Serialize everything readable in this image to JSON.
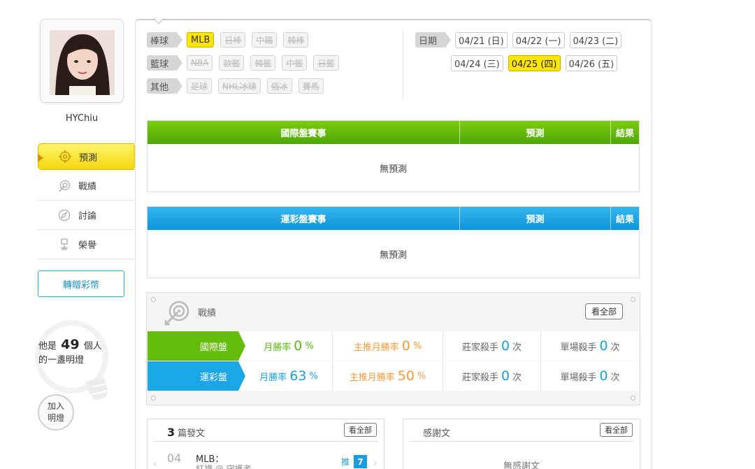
{
  "profile": {
    "username": "HYChiu"
  },
  "sidebar": {
    "items": [
      {
        "label": "預測",
        "icon": "target-icon",
        "active": true
      },
      {
        "label": "戰績",
        "icon": "record-icon",
        "active": false
      },
      {
        "label": "討論",
        "icon": "discuss-icon",
        "active": false
      },
      {
        "label": "榮譽",
        "icon": "medal-icon",
        "active": false
      }
    ],
    "donate_label": "轉贈彩幣",
    "lamp": {
      "prefix": "他是",
      "count": "49",
      "suffix": "個人",
      "line2": "的一盞明燈"
    },
    "join_lamp_line1": "加入",
    "join_lamp_line2": "明燈"
  },
  "categories": [
    {
      "label": "棒球",
      "items": [
        {
          "name": "MLB",
          "active": true
        },
        {
          "name": "日棒"
        },
        {
          "name": "中職"
        },
        {
          "name": "韓棒"
        }
      ]
    },
    {
      "label": "籃球",
      "items": [
        {
          "name": "NBA"
        },
        {
          "name": "歐籃"
        },
        {
          "name": "韓籃"
        },
        {
          "name": "中籃"
        },
        {
          "name": "日籃"
        }
      ]
    },
    {
      "label": "其他",
      "items": [
        {
          "name": "足球"
        },
        {
          "name": "NHL冰球"
        },
        {
          "name": "俄冰"
        },
        {
          "name": "賽馬"
        }
      ]
    }
  ],
  "dates": {
    "label": "日期",
    "row1": [
      {
        "text": "04/21 (日)"
      },
      {
        "text": "04/22 (一)"
      },
      {
        "text": "04/23 (二)"
      }
    ],
    "row2": [
      {
        "text": "04/24 (三)"
      },
      {
        "text": "04/25 (四)",
        "active": true
      },
      {
        "text": "04/26 (五)"
      }
    ]
  },
  "intl_table": {
    "col_event": "國際盤賽事",
    "col_predict": "預測",
    "col_result": "結果",
    "empty": "無預測"
  },
  "sport_table": {
    "col_event": "運彩盤賽事",
    "col_predict": "預測",
    "col_result": "結果",
    "empty": "無預測"
  },
  "record": {
    "title": "戰績",
    "view_all": "看全部",
    "rows": [
      {
        "label": "國際盤",
        "monthly_label": "月勝率",
        "monthly": "0",
        "main_label": "主推月勝率",
        "main": "0",
        "pct": "%",
        "banker_label": "莊家殺手",
        "banker": "0",
        "single_label": "單場殺手",
        "single": "0",
        "unit": "次"
      },
      {
        "label": "運彩盤",
        "monthly_label": "月勝率",
        "monthly": "63",
        "main_label": "主推月勝率",
        "main": "50",
        "pct": "%",
        "banker_label": "莊家殺手",
        "banker": "0",
        "single_label": "單場殺手",
        "single": "0",
        "unit": "次"
      }
    ]
  },
  "posts": {
    "count": "3",
    "title": "篇發文",
    "view_all": "看全部",
    "item": {
      "date": "04",
      "type": "MLB：",
      "sub": "紅襪 @ 守護者",
      "push_label": "推",
      "push_count": "7"
    }
  },
  "thanks": {
    "title": "感謝文",
    "view_all": "看全部",
    "empty": "無感謝文"
  },
  "colors": {
    "green": "#5db80c",
    "blue": "#1a9ddc",
    "orange": "#f39a3c",
    "yellow": "#ffe600"
  }
}
